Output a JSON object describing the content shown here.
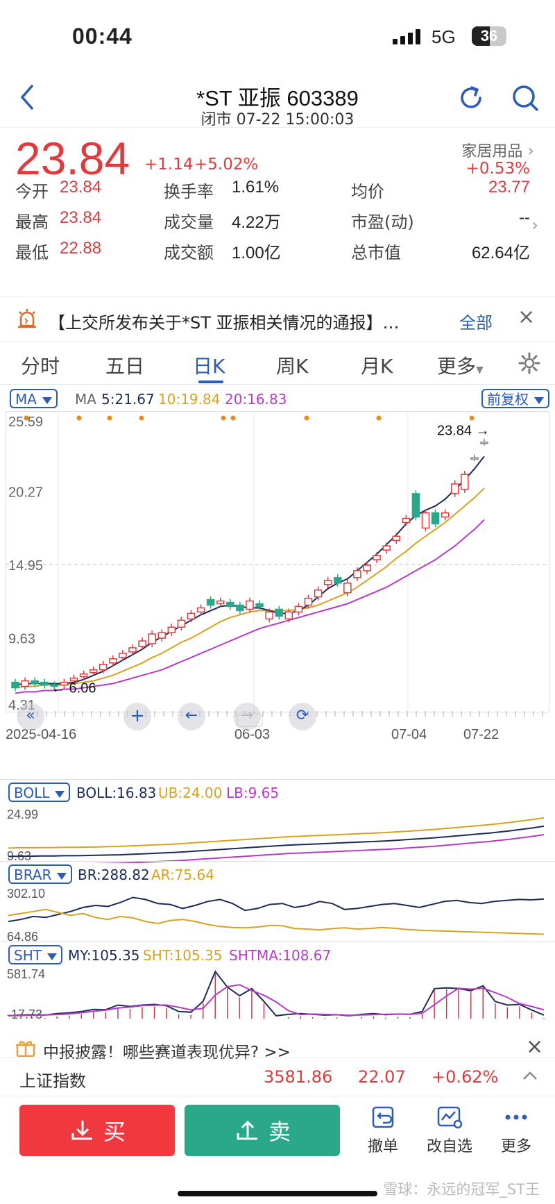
{
  "status": {
    "time": "00:44",
    "network": "5G",
    "battery": "36"
  },
  "header": {
    "title": "*ST 亚振 603389",
    "subtitle": "闭市 07-22 15:00:03"
  },
  "quote": {
    "price": "23.84",
    "change": "+1.14",
    "change_pct": "+5.02%",
    "sector": "家居用品",
    "sector_chg": "+0.53%",
    "grid": [
      {
        "label": "今开",
        "value": "23.84",
        "red": true
      },
      {
        "label": "换手率",
        "value": "1.61%",
        "red": false
      },
      {
        "label": "均价",
        "value": "23.77",
        "red": true
      },
      {
        "label": "最高",
        "value": "23.84",
        "red": true
      },
      {
        "label": "成交量",
        "value": "4.22万",
        "red": false
      },
      {
        "label": "市盈(动)",
        "value": "--",
        "red": false
      },
      {
        "label": "最低",
        "value": "22.88",
        "red": true
      },
      {
        "label": "成交额",
        "value": "1.00亿",
        "red": false
      },
      {
        "label": "总市值",
        "value": "62.64亿",
        "red": false
      }
    ]
  },
  "notice": {
    "text": "【上交所发布关于*ST 亚振相关情况的通报】…",
    "all": "全部"
  },
  "tabs": [
    "分时",
    "五日",
    "日K",
    "周K",
    "月K",
    "更多"
  ],
  "active_tab": 2,
  "ma": {
    "selector": "MA",
    "label": "MA",
    "ma5": "5:21.67",
    "ma10": "10:19.84",
    "ma20": "20:16.83",
    "adjust": "前复权"
  },
  "colors": {
    "up": "#e03a3e",
    "down": "#2aa889",
    "accent": "#2a5cb8",
    "ma5": "#1c2b56",
    "ma10": "#d9a21e",
    "ma20": "#b63bc7"
  },
  "chart_data": {
    "type": "candlestick",
    "y_ticks": [
      "25.59",
      "20.27",
      "14.95",
      "9.63",
      "4.31"
    ],
    "x_ticks": [
      "2025-04-16",
      "06-03",
      "07-04",
      "07-22"
    ],
    "ylim": [
      4.31,
      25.59
    ],
    "max_label": "23.84",
    "min_label": "6.06",
    "closes": [
      6.0,
      6.5,
      6.3,
      6.2,
      6.1,
      6.4,
      6.7,
      7.0,
      7.3,
      7.7,
      8.1,
      8.5,
      8.9,
      9.4,
      9.9,
      10.0,
      10.4,
      10.9,
      11.4,
      11.8,
      12.0,
      12.3,
      11.9,
      11.6,
      12.3,
      11.9,
      11.5,
      11.2,
      11.5,
      11.9,
      12.5,
      13.1,
      13.8,
      13.6,
      13.6,
      14.5,
      14.9,
      15.6,
      16.3,
      17.0,
      18.3,
      18.4,
      18.7,
      17.9,
      18.7,
      20.8,
      21.5,
      22.7,
      23.84
    ],
    "opens": [
      6.4,
      6.1,
      6.5,
      6.4,
      6.2,
      6.2,
      6.5,
      6.8,
      7.1,
      7.3,
      7.8,
      8.2,
      8.6,
      9.0,
      9.2,
      9.6,
      10.0,
      10.4,
      11.0,
      11.5,
      12.4,
      12.1,
      12.2,
      12.0,
      11.7,
      12.1,
      11.0,
      11.7,
      11.0,
      11.5,
      12.0,
      12.6,
      13.5,
      14.0,
      12.9,
      14.0,
      14.5,
      15.3,
      16.0,
      16.7,
      18.0,
      20.1,
      17.6,
      18.7,
      18.4,
      20.1,
      20.4,
      22.7,
      23.84
    ],
    "ma5": [
      6.2,
      6.3,
      6.3,
      6.3,
      6.3,
      6.3,
      6.4,
      6.6,
      6.9,
      7.2,
      7.6,
      8.0,
      8.4,
      8.8,
      9.3,
      9.7,
      10.1,
      10.5,
      10.9,
      11.3,
      11.6,
      11.9,
      12.0,
      11.9,
      11.8,
      11.8,
      11.6,
      11.4,
      11.4,
      11.6,
      12.0,
      12.6,
      13.2,
      13.6,
      13.9,
      14.5,
      15.1,
      15.7,
      16.4,
      17.1,
      17.9,
      18.5,
      18.9,
      19.2,
      19.7,
      20.4,
      21.1,
      21.9,
      22.8
    ],
    "ma10": [
      6.0,
      6.1,
      6.1,
      6.2,
      6.2,
      6.2,
      6.3,
      6.4,
      6.5,
      6.7,
      6.9,
      7.2,
      7.5,
      7.8,
      8.2,
      8.5,
      8.9,
      9.3,
      9.6,
      10.0,
      10.4,
      10.8,
      11.1,
      11.3,
      11.5,
      11.6,
      11.6,
      11.6,
      11.6,
      11.7,
      11.8,
      12.0,
      12.3,
      12.6,
      12.9,
      13.3,
      13.8,
      14.3,
      14.8,
      15.4,
      15.9,
      16.5,
      17.0,
      17.5,
      18.0,
      18.6,
      19.2,
      19.8,
      20.5
    ],
    "ma20": [
      5.6,
      5.7,
      5.7,
      5.8,
      5.8,
      5.9,
      5.9,
      6.0,
      6.1,
      6.2,
      6.3,
      6.5,
      6.7,
      6.9,
      7.1,
      7.3,
      7.6,
      7.9,
      8.2,
      8.5,
      8.8,
      9.1,
      9.4,
      9.7,
      10.0,
      10.3,
      10.5,
      10.7,
      10.9,
      11.1,
      11.3,
      11.5,
      11.7,
      11.9,
      12.1,
      12.4,
      12.7,
      13.0,
      13.3,
      13.7,
      14.1,
      14.5,
      14.9,
      15.3,
      15.8,
      16.3,
      16.9,
      17.5,
      18.2
    ]
  },
  "boll": {
    "selector": "BOLL",
    "label": "BOLL:16.83",
    "ub": "UB:24.00",
    "lb": "LB:9.65",
    "y_ticks": [
      "24.99",
      "9.63"
    ]
  },
  "brar": {
    "selector": "BRAR",
    "br": "BR:288.82",
    "ar": "AR:75.64",
    "y_ticks": [
      "302.10",
      "64.86"
    ]
  },
  "sht": {
    "selector": "SHT",
    "my": "MY:105.35",
    "sht": "SHT:105.35",
    "shtma": "SHTMA:108.67",
    "y_ticks": [
      "581.74",
      "-17.73"
    ]
  },
  "promo": {
    "text": "中报披露！哪些赛道表现优异? >>"
  },
  "index": {
    "name": "上证指数",
    "value": "3581.86",
    "change": "22.07",
    "change_pct": "+0.62%"
  },
  "actions": {
    "buy": "买",
    "sell": "卖",
    "cancel": "撤单",
    "edit_watch": "改自选",
    "more": "更多"
  },
  "watermark": "雪球：永远的冠军_ST王"
}
